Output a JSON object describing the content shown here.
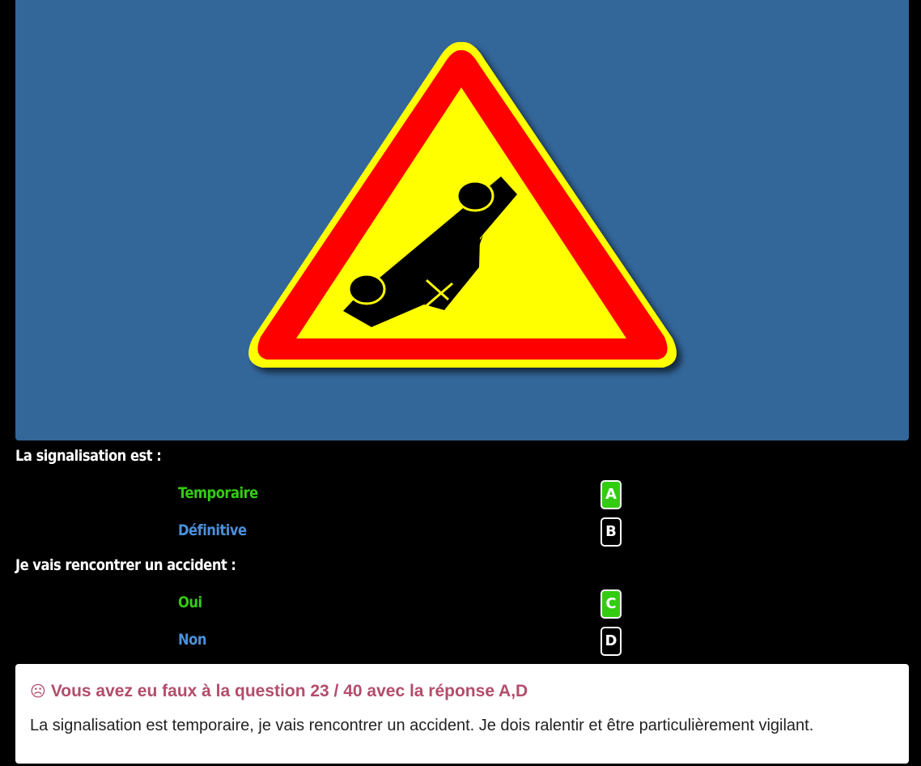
{
  "sign_image": {
    "panel_color": "#336699",
    "icon": "overturned-car-warning-sign-icon",
    "border_color": "#ff0000",
    "fill_color": "#ffff00"
  },
  "questions": [
    {
      "text": "La signalisation est :",
      "answers": [
        {
          "label": "Temporaire",
          "letter": "A",
          "status": "correct",
          "selected": true
        },
        {
          "label": "Définitive",
          "letter": "B",
          "status": "wrong",
          "selected": false
        }
      ]
    },
    {
      "text": "Je vais rencontrer un accident :",
      "answers": [
        {
          "label": "Oui",
          "letter": "C",
          "status": "correct",
          "selected": true
        },
        {
          "label": "Non",
          "letter": "D",
          "status": "wrong",
          "selected": false
        }
      ]
    }
  ],
  "colors": {
    "correct": "#33cc11",
    "wrong": "#4a90d9",
    "feedback_title": "#b34d6b"
  },
  "feedback": {
    "icon": "sad-face-icon",
    "icon_glyph": "☹",
    "title": "Vous avez eu faux à la question 23 / 40 avec la réponse A,D",
    "explanation": "La signalisation est temporaire, je vais rencontrer un accident. Je dois ralentir et être particulièrement vigilant."
  }
}
